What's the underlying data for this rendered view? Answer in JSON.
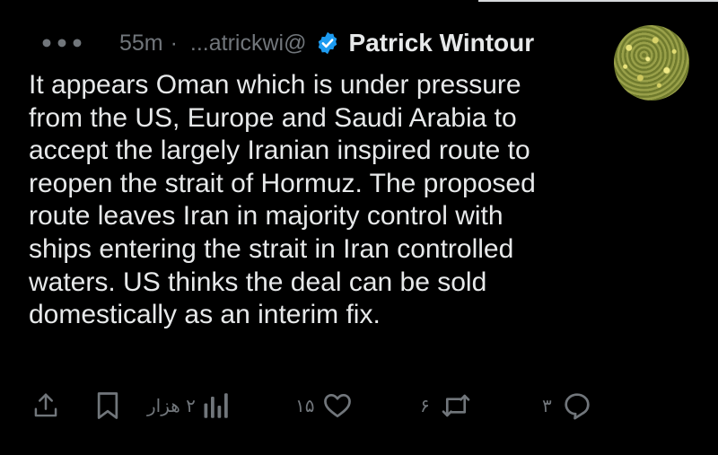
{
  "post": {
    "more_label": "•••",
    "time": "55m",
    "separator": "·",
    "handle": "...atrickwi@",
    "author_name": "Patrick Wintour",
    "text": "It appears Oman which is under pressure\nfrom the US, Europe and Saudi Arabia to\naccept the largely Iranian inspired route to\nreopen the strait of Hormuz.  The proposed\nroute leaves Iran in majority control with\nships entering the strait in Iran controlled\nwaters.  US thinks the deal can be sold\ndomestically as an interim fix."
  },
  "actions": {
    "share_icon": "share-icon",
    "bookmark_icon": "bookmark-icon",
    "views_icon": "bar-chart-icon",
    "views_count": "۲ هزار",
    "likes_icon": "heart-icon",
    "likes_count": "۱۵",
    "reposts_icon": "repost-icon",
    "reposts_count": "۶",
    "replies_icon": "reply-icon",
    "replies_count": "۳"
  },
  "colors": {
    "background": "#000000",
    "text": "#e7e9ea",
    "muted": "#71767b",
    "verified": "#1d9bf0"
  }
}
